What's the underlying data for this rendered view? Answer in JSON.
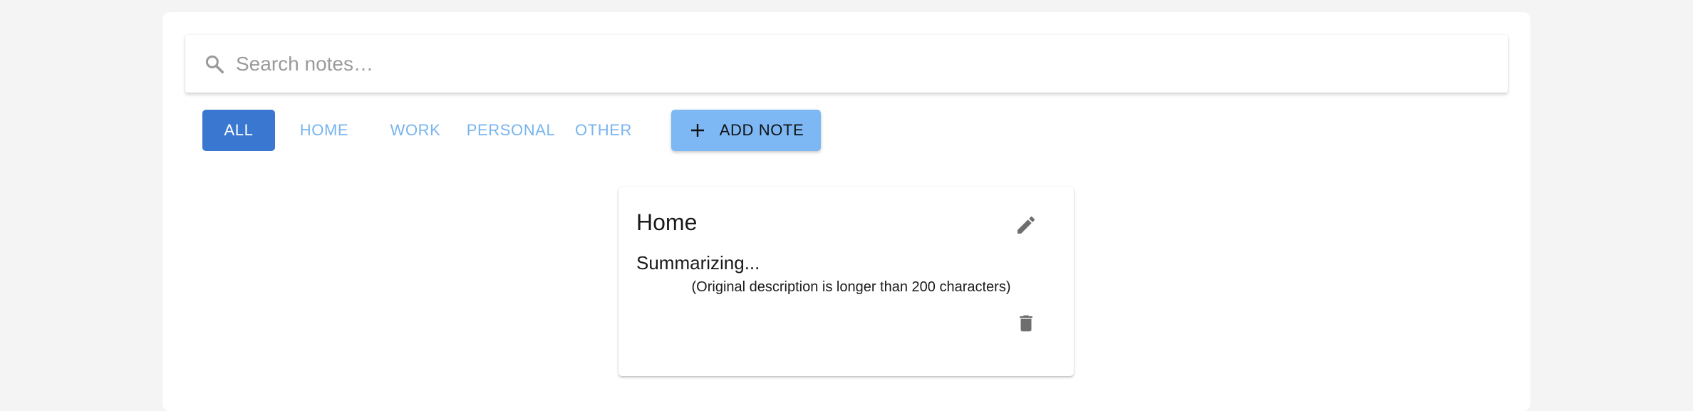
{
  "search": {
    "placeholder": "Search notes…",
    "icon": "search-icon"
  },
  "filters": [
    {
      "label": "ALL",
      "active": true
    },
    {
      "label": "HOME",
      "active": false
    },
    {
      "label": "WORK",
      "active": false
    },
    {
      "label": "PERSONAL",
      "active": false
    },
    {
      "label": "OTHER",
      "active": false
    }
  ],
  "add_note": {
    "label": "ADD NOTE",
    "icon": "plus-icon"
  },
  "notes": [
    {
      "title": "Home",
      "summary": "Summarizing...",
      "caption": "(Original description is longer than 200 characters)",
      "edit_icon": "pencil-icon",
      "delete_icon": "trash-icon"
    }
  ],
  "colors": {
    "background": "#f4f4f4",
    "active_filter": "#3977d1",
    "filter_text": "#78b4ee",
    "add_button": "#7db8f4",
    "icon_gray": "#6e6e6e"
  }
}
